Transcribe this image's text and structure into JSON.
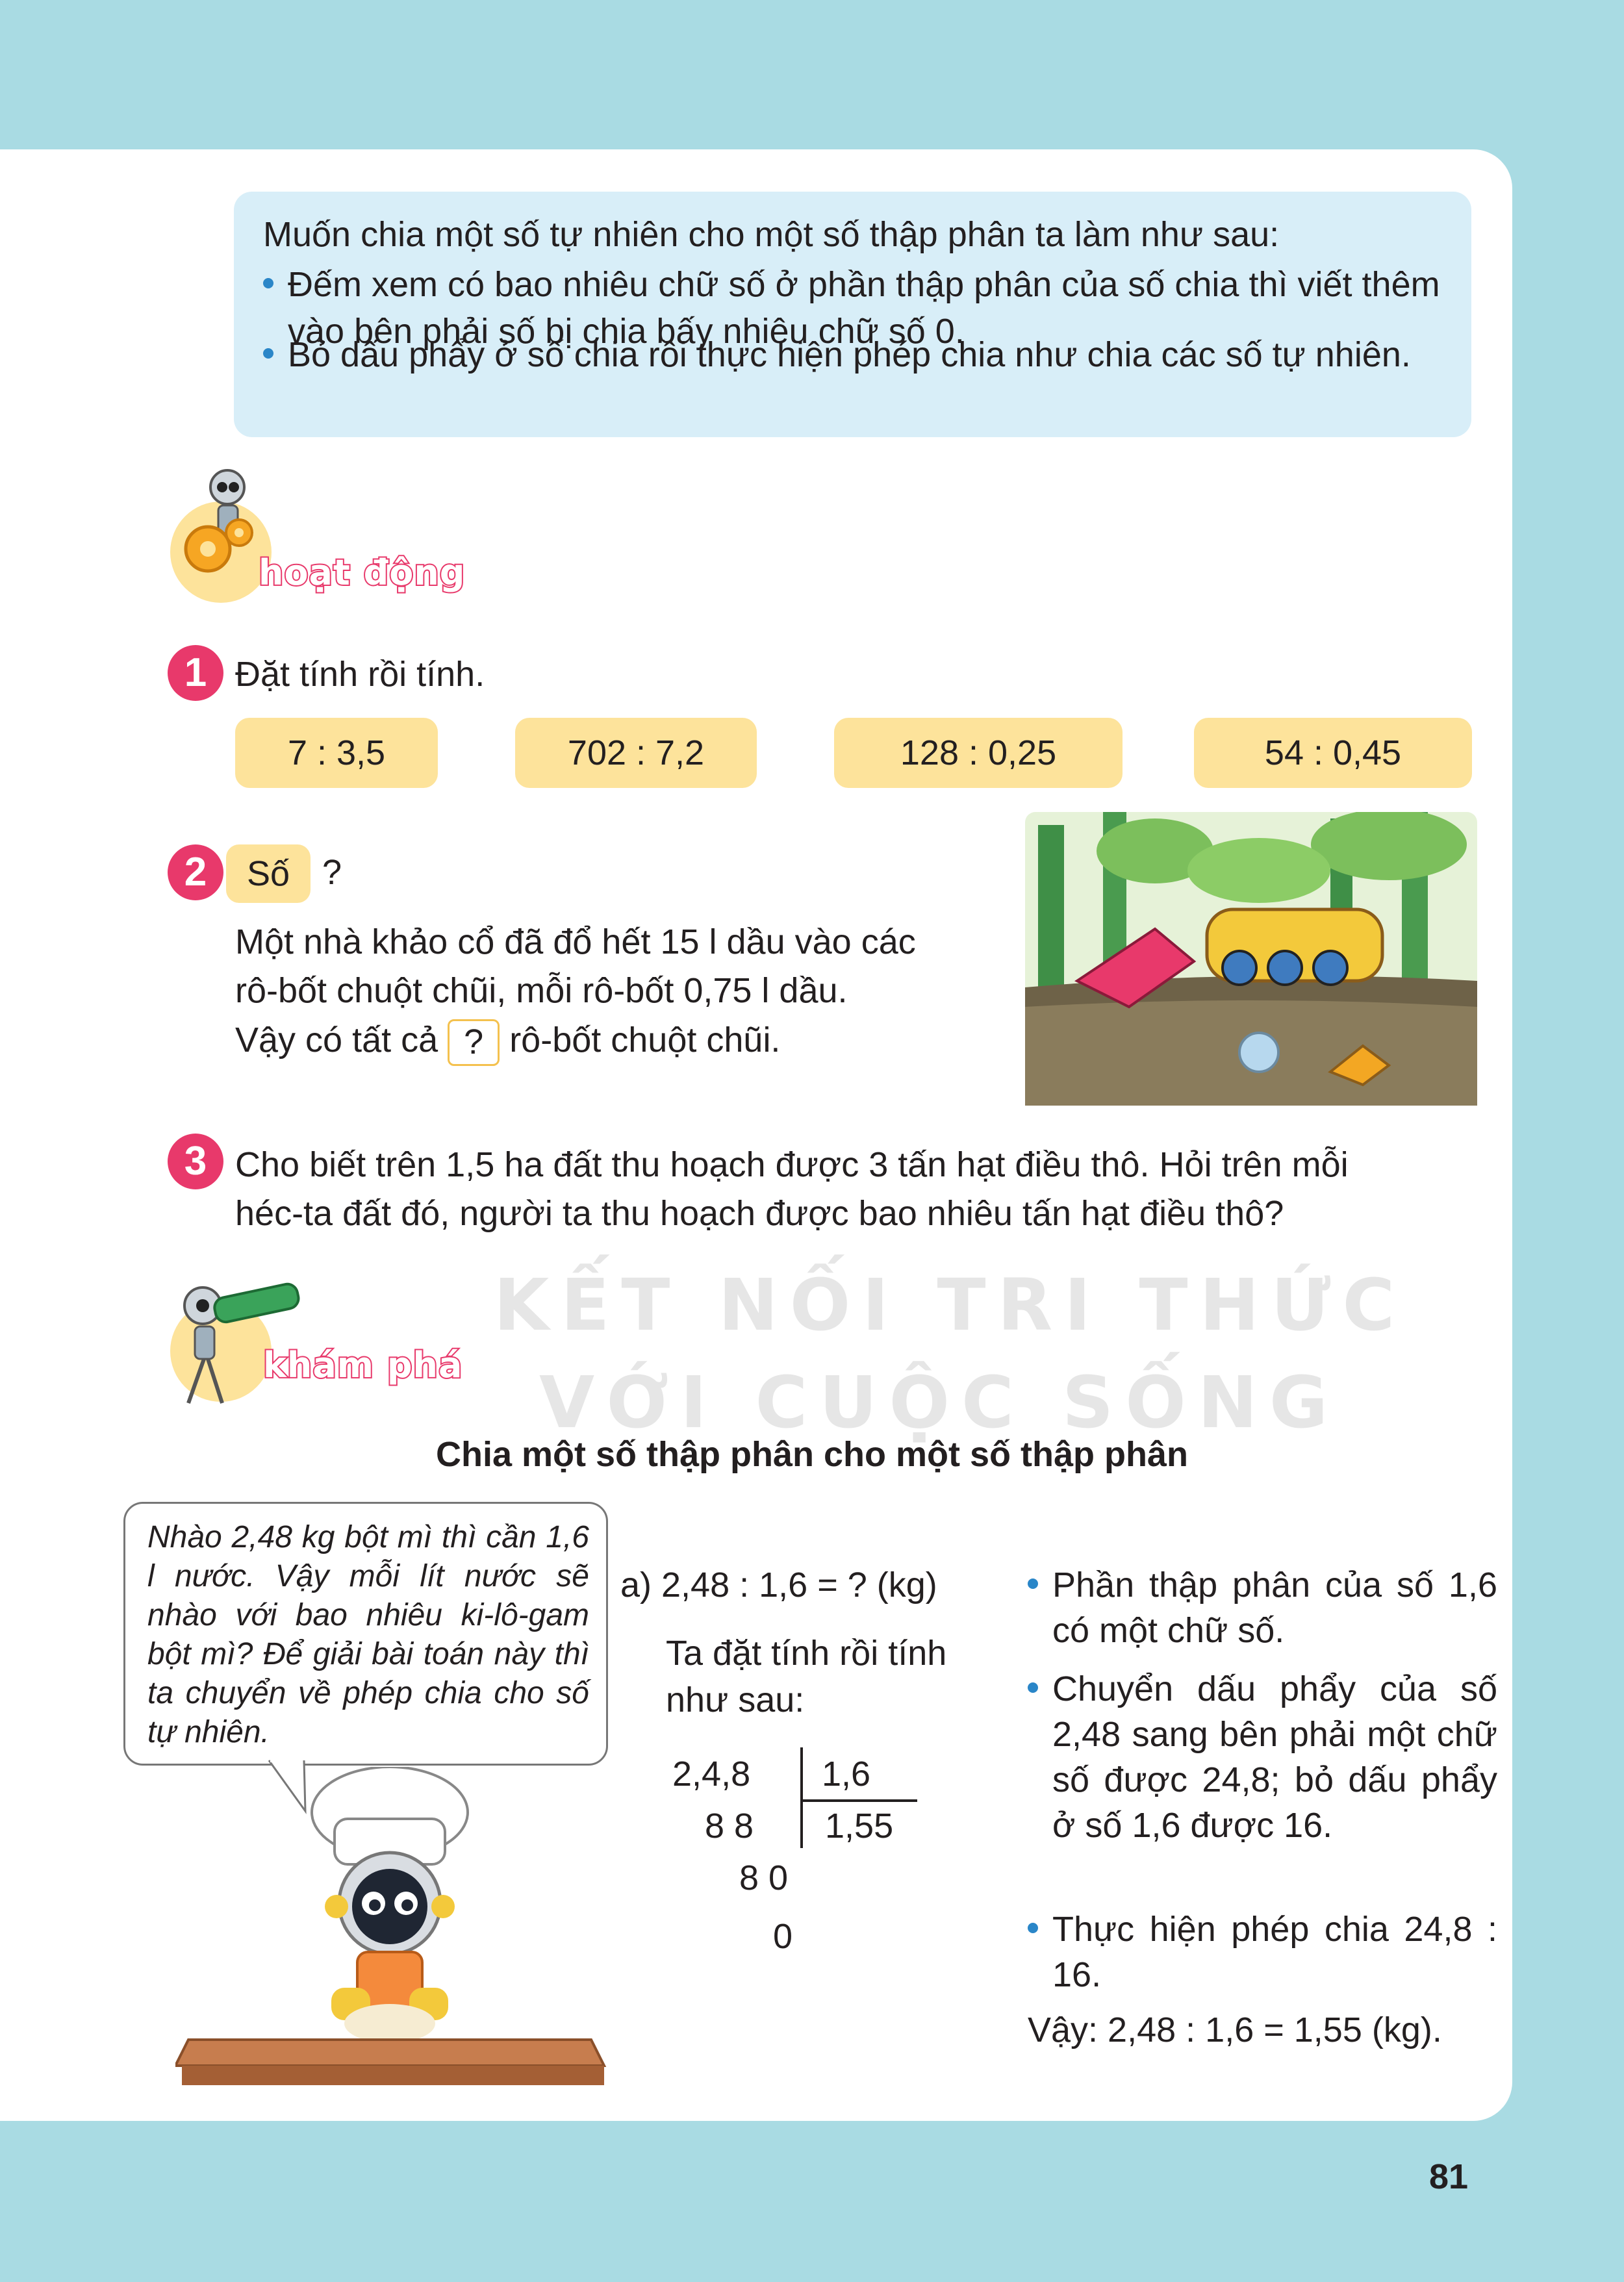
{
  "rule": {
    "intro": "Muốn chia một số tự nhiên cho một số thập phân ta làm như sau:",
    "bullets": [
      "Đếm xem có bao nhiêu chữ số ở phần thập phân của số chia thì viết thêm vào bên phải số bị chia bấy nhiêu chữ số 0.",
      "Bỏ dấu phẩy ở số chia rồi thực hiện phép chia như chia các số tự nhiên."
    ]
  },
  "activity": {
    "title": "hoạt động",
    "ex1": {
      "num": "1",
      "instruction": "Đặt tính rồi tính.",
      "items": [
        "7 : 3,5",
        "702 : 7,2",
        "128 : 0,25",
        "54 : 0,45"
      ]
    },
    "ex2": {
      "num": "2",
      "tag": "Số",
      "question_mark": "?",
      "line1": "Một nhà khảo cổ đã đổ hết 15 l dầu vào các",
      "line2": "rô-bốt chuột chũi, mỗi rô-bốt 0,75 l dầu.",
      "line3_a": "Vậy có tất cả",
      "blank": "?",
      "line3_b": "rô-bốt chuột chũi."
    },
    "ex3": {
      "num": "3",
      "line1": "Cho biết trên 1,5 ha đất thu hoạch được 3 tấn hạt điều thô. Hỏi trên mỗi",
      "line2": "héc-ta đất đó, người ta thu hoạch được bao nhiêu tấn hạt điều thô?"
    }
  },
  "watermark": {
    "line1": "KẾT NỐI TRI THỨC",
    "line2": "VỚI CUỘC SỐNG"
  },
  "explore": {
    "title": "khám phá",
    "subtitle": "Chia một số thập phân cho một số thập phân",
    "bubble": "Nhào 2,48 kg bột mì thì cần 1,6 l nước. Vậy mỗi lít nước sẽ nhào với bao nhiêu ki-lô-gam bột mì? Để giải bài toán này thì ta chuyển về phép chia cho số tự nhiên.",
    "part_a": "a) 2,48 : 1,6 = ? (kg)",
    "setup_1": "Ta đặt tính rồi tính",
    "setup_2": "như sau:",
    "division": {
      "dividend": "2,4,8",
      "divisor": "1,6",
      "quotient": "1,55",
      "r1": "8 8",
      "r2": "8 0",
      "r3": "0"
    },
    "notes": [
      "Phần thập phân của số 1,6 có một chữ số.",
      "Chuyển dấu phẩy của số 2,48 sang bên phải một chữ số được 24,8; bỏ dấu phẩy ở số 1,6 được 16.",
      "Thực hiện phép chia 24,8 : 16."
    ],
    "conclusion": "Vậy: 2,48 : 1,6 = 1,55 (kg)."
  },
  "page_number": "81",
  "colors": {
    "accent": "#e8396b",
    "pill": "#fde39b",
    "rule_bg": "#d8eef8",
    "border": "#a9dbe3"
  },
  "icons": [
    "robot-gear-icon",
    "robot-telescope-icon",
    "robot-chef-illustration",
    "mole-robots-illustration"
  ]
}
